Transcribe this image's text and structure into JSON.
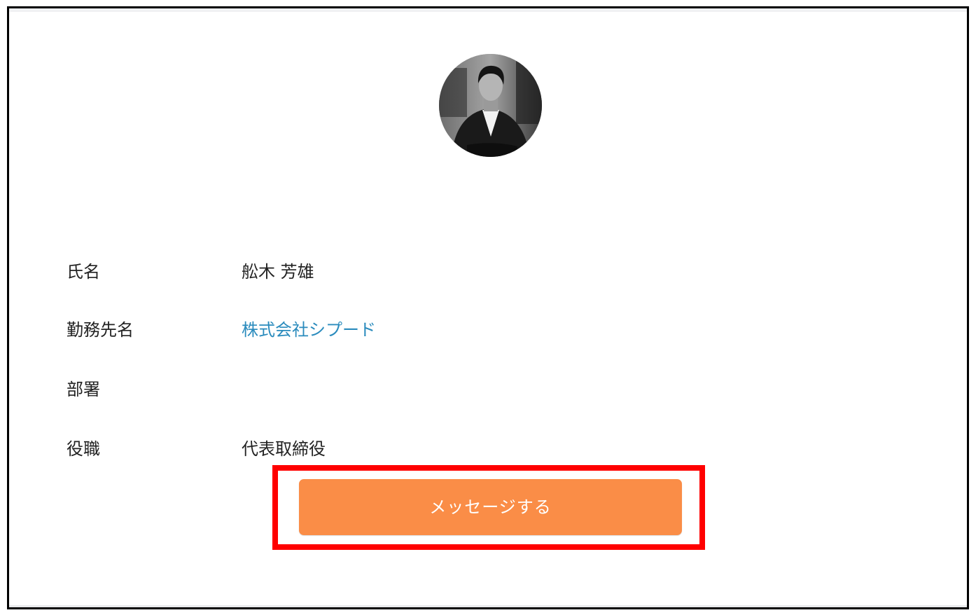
{
  "profile": {
    "avatar_icon": "profile-photo",
    "fields": [
      {
        "label": "氏名",
        "value": "舩木 芳雄"
      },
      {
        "label": "勤務先名",
        "value": "株式会社シプード"
      },
      {
        "label": "部署",
        "value": ""
      },
      {
        "label": "役職",
        "value": "代表取締役"
      }
    ]
  },
  "actions": {
    "message_button_label": "メッセージする"
  },
  "colors": {
    "button": "#fa8d47",
    "link": "#2a8bbd",
    "highlight": "#ff0000"
  }
}
